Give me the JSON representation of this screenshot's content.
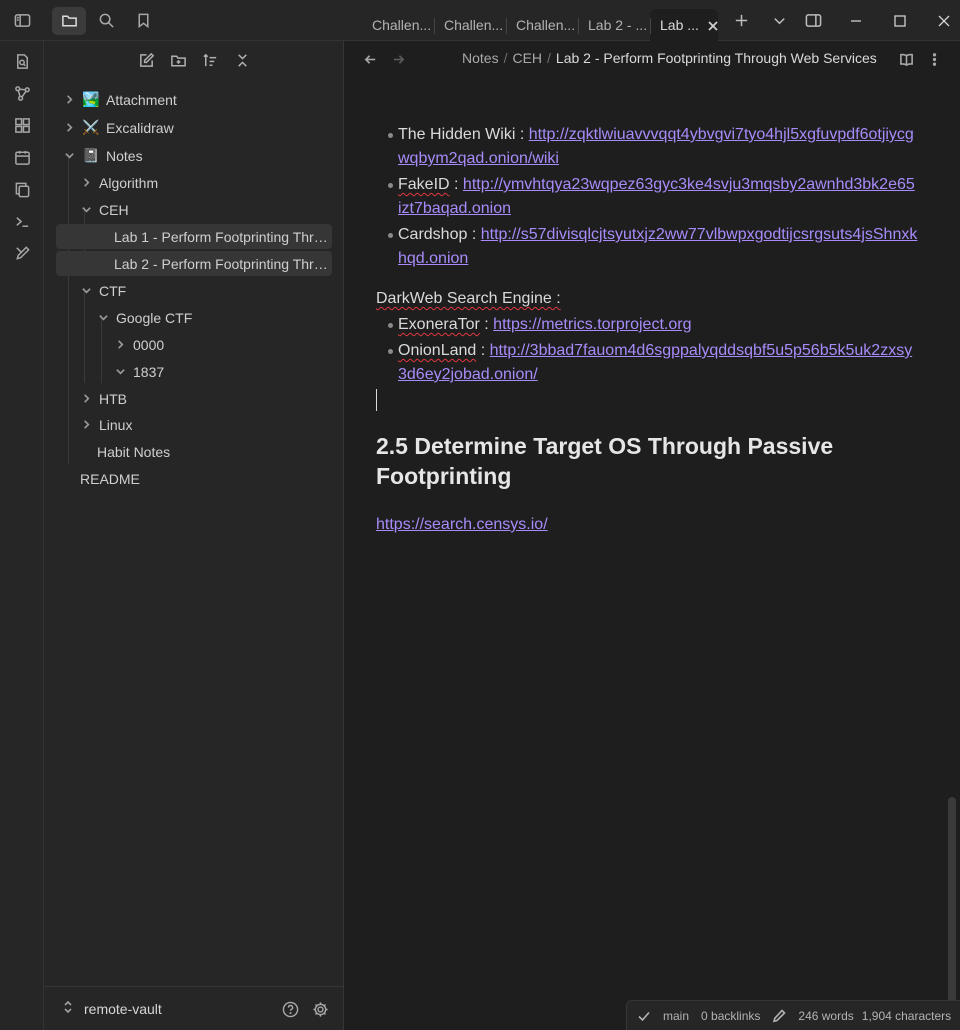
{
  "tabs": [
    {
      "label": "Challen..."
    },
    {
      "label": "Challen..."
    },
    {
      "label": "Challen..."
    },
    {
      "label": "Lab 2 - ..."
    },
    {
      "label": "Lab ..."
    }
  ],
  "breadcrumb": {
    "part1": "Notes",
    "part2": "CEH",
    "current": "Lab 2 - Perform Footprinting Through Web Services",
    "sep": "/"
  },
  "tree": {
    "attachment": "Attachment",
    "attachment_emoji": "🏞️",
    "excalidraw": "Excalidraw",
    "excalidraw_emoji": "⚔️",
    "notes": "Notes",
    "notes_emoji": "📓",
    "algorithm": "Algorithm",
    "ceh": "CEH",
    "lab1": "Lab 1 - Perform Footprinting Thro...",
    "lab2": "Lab 2 - Perform Footprinting Thro...",
    "ctf": "CTF",
    "google_ctf": "Google CTF",
    "f0000": "0000",
    "f1837": "1837",
    "htb": "HTB",
    "linux": "Linux",
    "habit": "Habit Notes",
    "readme": "README"
  },
  "vault": {
    "name": "remote-vault"
  },
  "content": {
    "items1": [
      {
        "name": "The Hidden Wiki",
        "sep": " : ",
        "url": "http://zqktlwiuavvvqqt4ybvgvi7tyo4hjl5xgfuvpdf6otjiycgwqbym2qad.onion/wiki"
      },
      {
        "name": "FakeID",
        "sep": " : ",
        "url": "http://ymvhtqya23wqpez63gyc3ke4svju3mqsby2awnhd3bk2e65izt7baqad.onion"
      },
      {
        "name": "Cardshop",
        "sep": " : ",
        "url": "http://s57divisqlcjtsyutxjz2ww77vlbwpxgodtijcsrgsuts4jsShnxkhqd.onion"
      }
    ],
    "darkweb_label": "DarkWeb Search Engine :",
    "items2": [
      {
        "name": "ExoneraTor",
        "sep": " : ",
        "url": "https://metrics.torproject.org"
      },
      {
        "name": "OnionLand",
        "sep": " : ",
        "url": "http://3bbad7fauom4d6sgppalyqddsqbf5u5p56b5k5uk2zxsy3d6ey2jobad.onion/"
      }
    ],
    "heading": "2.5 Determine Target OS Through Passive Footprinting",
    "link": "https://search.censys.io/"
  },
  "status": {
    "branch": "main",
    "backlinks": "0 backlinks",
    "words": "246 words",
    "chars": "1,904 characters"
  },
  "colors": {
    "accent": "#a88bfa",
    "spell_error": "#e0383e"
  }
}
